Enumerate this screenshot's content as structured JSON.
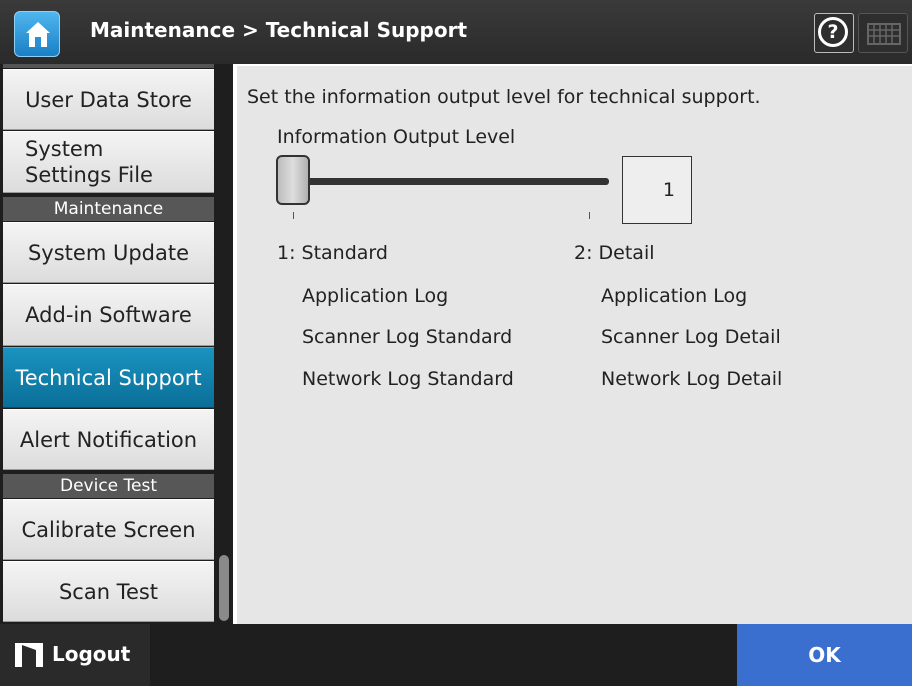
{
  "header": {
    "title": "Maintenance > Technical Support",
    "help_symbol": "?"
  },
  "sidebar": {
    "items": [
      {
        "label": "User Data Store"
      },
      {
        "label": "System Settings File"
      },
      {
        "label": "System Update"
      },
      {
        "label": "Add-in Software"
      },
      {
        "label": "Technical Support",
        "active": true
      },
      {
        "label": "Alert Notification"
      },
      {
        "label": "Calibrate Screen"
      },
      {
        "label": "Scan Test"
      }
    ],
    "sections": [
      "Maintenance",
      "Device Test"
    ]
  },
  "main": {
    "description": "Set the information output level for technical support.",
    "slider_label": "Information Output Level",
    "slider_value": "1",
    "slider_min": 1,
    "slider_max": 2,
    "levels": [
      {
        "heading": "1: Standard",
        "items": [
          "Application Log",
          "Scanner Log Standard",
          "Network Log Standard"
        ]
      },
      {
        "heading": "2: Detail",
        "items": [
          "Application Log",
          "Scanner Log Detail",
          "Network Log Detail"
        ]
      }
    ]
  },
  "footer": {
    "logout_label": "Logout",
    "ok_label": "OK"
  },
  "colors": {
    "active_item": "#0a7aa8",
    "ok_button": "#3a6fcf",
    "header_bg": "#2f2f2f"
  },
  "icons": [
    "home-icon",
    "help-icon",
    "keyboard-icon",
    "logout-icon"
  ]
}
